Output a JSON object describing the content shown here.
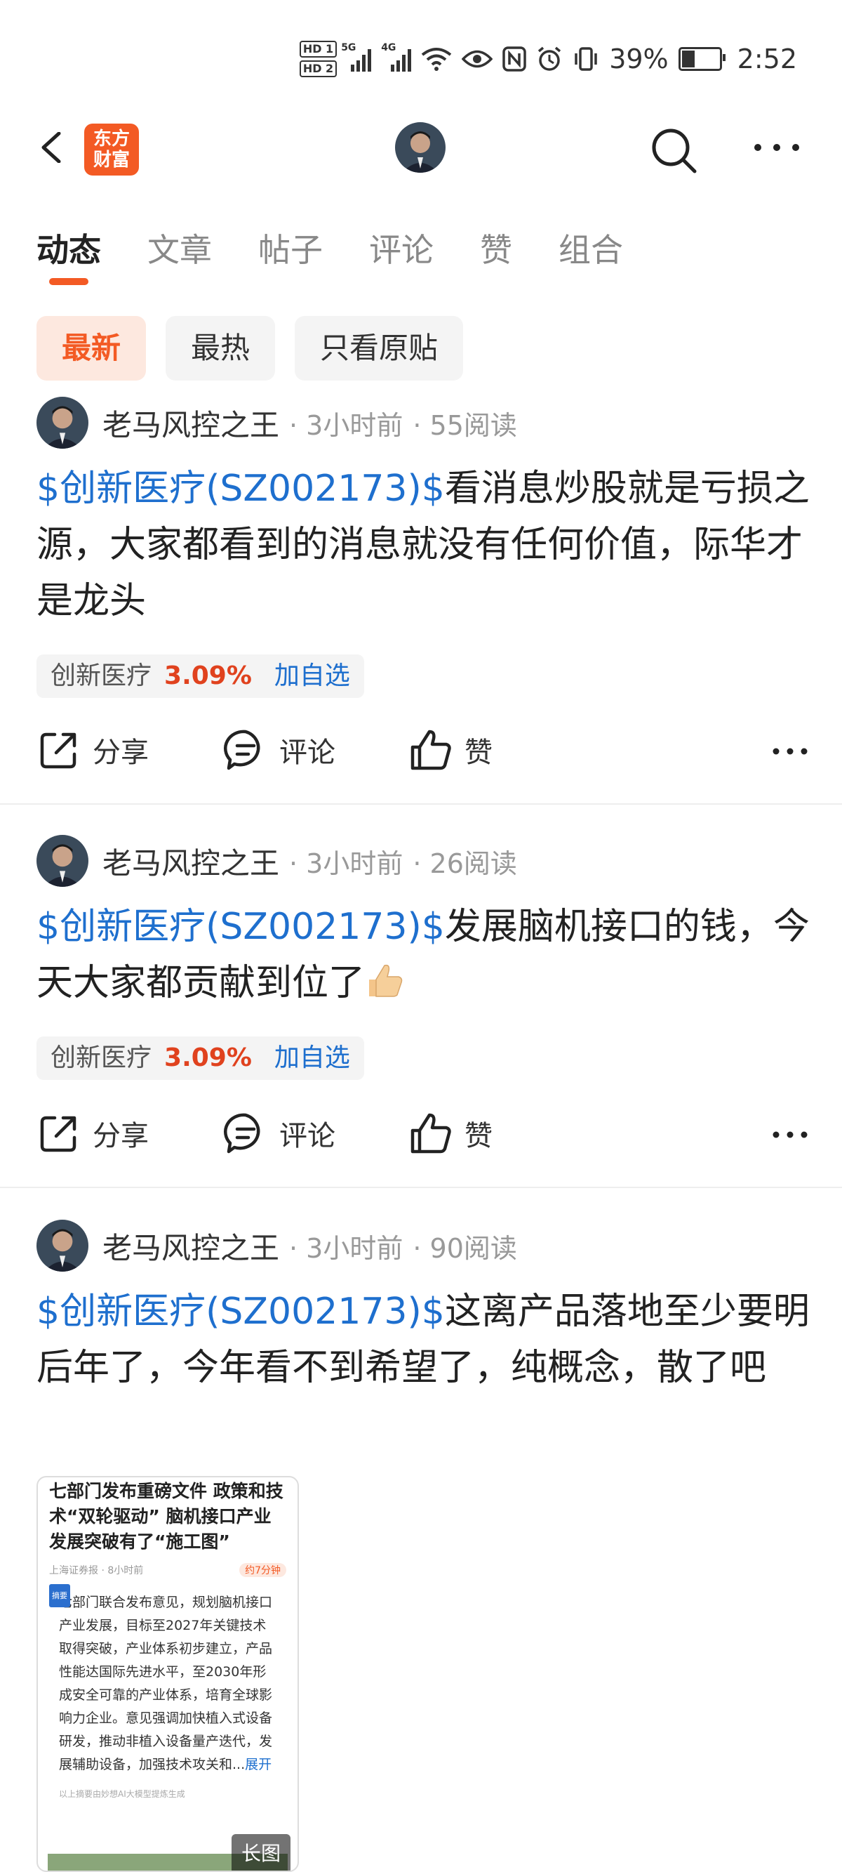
{
  "status_bar": {
    "battery": "39%",
    "time": "2:52",
    "hd1": "HD 1",
    "hd2": "HD 2",
    "net1": "5G",
    "net2": "4G"
  },
  "nav": {
    "logo_line1": "东方",
    "logo_line2": "财富"
  },
  "tabs": [
    {
      "label": "动态",
      "active": true
    },
    {
      "label": "文章"
    },
    {
      "label": "帖子"
    },
    {
      "label": "评论"
    },
    {
      "label": "赞"
    },
    {
      "label": "组合"
    }
  ],
  "filters": [
    {
      "label": "最新",
      "active": true
    },
    {
      "label": "最热"
    },
    {
      "label": "只看原贴"
    }
  ],
  "posts": [
    {
      "author": "老马风控之王",
      "time": "· 3小时前",
      "reads": "· 55阅读",
      "stock_tag": "$创新医疗(SZ002173)$",
      "text": "看消息炒股就是亏损之源，大家都看到的消息就没有任何价值，际华才是龙头",
      "stock_name": "创新医疗",
      "stock_change": "3.09%",
      "add_watch": "加自选",
      "share": "分享",
      "comment": "评论",
      "like": "赞"
    },
    {
      "author": "老马风控之王",
      "time": "· 3小时前",
      "reads": "· 26阅读",
      "stock_tag": "$创新医疗(SZ002173)$",
      "text": "发展脑机接口的钱，今天大家都贡献到位了",
      "stock_name": "创新医疗",
      "stock_change": "3.09%",
      "add_watch": "加自选",
      "share": "分享",
      "comment": "评论",
      "like": "赞"
    },
    {
      "author": "老马风控之王",
      "time": "· 3小时前",
      "reads": "· 90阅读",
      "stock_tag": "$创新医疗(SZ002173)$",
      "text": "这离产品落地至少要明后年了，今年看不到希望了，纯概念，散了吧",
      "image": {
        "title": "七部门发布重磅文件 政策和技术“双轮驱动” 脑机接口产业发展突破有了“施工图”",
        "source": "上海证券报 · 8小时前",
        "read_time": "约7分钟",
        "abstract_label": "摘要",
        "abstract": "七部门联合发布意见，规划脑机接口产业发展，目标至2027年关键技术取得突破，产业体系初步建立，产品性能达国际先进水平，至2030年形成安全可靠的产业体系，培育全球影响力企业。意见强调加快植入式设备研发，推动非植入设备量产迭代，发展辅助设备，加强技术攻关和...",
        "more": "展开",
        "footer": "以上摘要由妙想AI大模型提炼生成",
        "long_tag": "长图"
      }
    }
  ]
}
